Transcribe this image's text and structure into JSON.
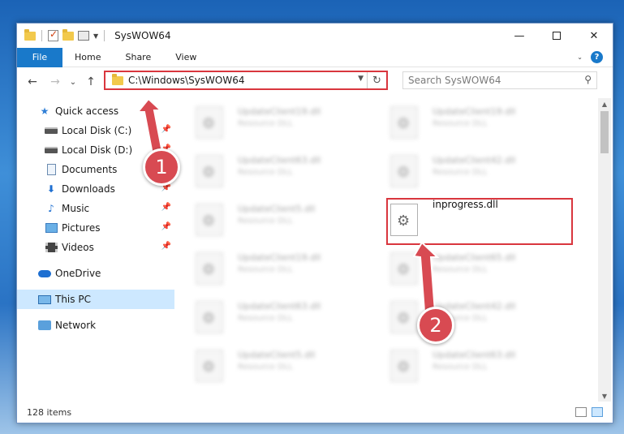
{
  "window": {
    "title": "SysWOW64",
    "controls": {
      "minimize": "—",
      "close": "✕"
    }
  },
  "ribbon": {
    "file": "File",
    "tabs": [
      "Home",
      "Share",
      "View"
    ],
    "help": "?"
  },
  "nav": {
    "back": "←",
    "forward": "→",
    "recent": "⌄",
    "up": "↑",
    "address": "C:\\Windows\\SysWOW64",
    "refresh": "↻",
    "search_placeholder": "Search SysWOW64"
  },
  "sidebar": {
    "items": [
      {
        "label": "Quick access",
        "icon": "star-icon",
        "pinned": false
      },
      {
        "label": "Local Disk (C:)",
        "icon": "disk-icon",
        "pinned": true
      },
      {
        "label": "Local Disk (D:)",
        "icon": "disk-icon",
        "pinned": true
      },
      {
        "label": "Documents",
        "icon": "documents-icon",
        "pinned": true
      },
      {
        "label": "Downloads",
        "icon": "downloads-icon",
        "pinned": true
      },
      {
        "label": "Music",
        "icon": "music-icon",
        "pinned": true
      },
      {
        "label": "Pictures",
        "icon": "pictures-icon",
        "pinned": true
      },
      {
        "label": "Videos",
        "icon": "videos-icon",
        "pinned": true
      },
      {
        "label": "OneDrive",
        "icon": "onedrive-icon",
        "pinned": false
      },
      {
        "label": "This PC",
        "icon": "this-pc-icon",
        "pinned": false,
        "selected": true
      },
      {
        "label": "Network",
        "icon": "network-icon",
        "pinned": false
      }
    ]
  },
  "files": [
    {
      "name": "UpdateClient19.dll",
      "type": "Resource DLL"
    },
    {
      "name": "UpdateClient19.dll",
      "type": "Resource DLL"
    },
    {
      "name": "UpdateClient63.dll",
      "type": "Resource DLL"
    },
    {
      "name": "UpdateClient42.dll",
      "type": "Resource DLL"
    },
    {
      "name": "UpdateClient5.dll",
      "type": "Resource DLL"
    },
    {
      "name": "inprogress.dll",
      "type": ""
    },
    {
      "name": "UpdateClient19.dll",
      "type": "Resource DLL"
    },
    {
      "name": "UpdateClient65.dll",
      "type": "Resource DLL"
    },
    {
      "name": "UpdateClient63.dll",
      "type": "Resource DLL"
    },
    {
      "name": "UpdateClient42.dll",
      "type": "Resource DLL"
    },
    {
      "name": "UpdateClient5.dll",
      "type": "Resource DLL"
    },
    {
      "name": "UpdateClient63.dll",
      "type": "Resource DLL"
    }
  ],
  "status": {
    "item_count": "128 items"
  },
  "annotations": {
    "step1": "1",
    "step2": "2",
    "color": "#d84a52"
  }
}
